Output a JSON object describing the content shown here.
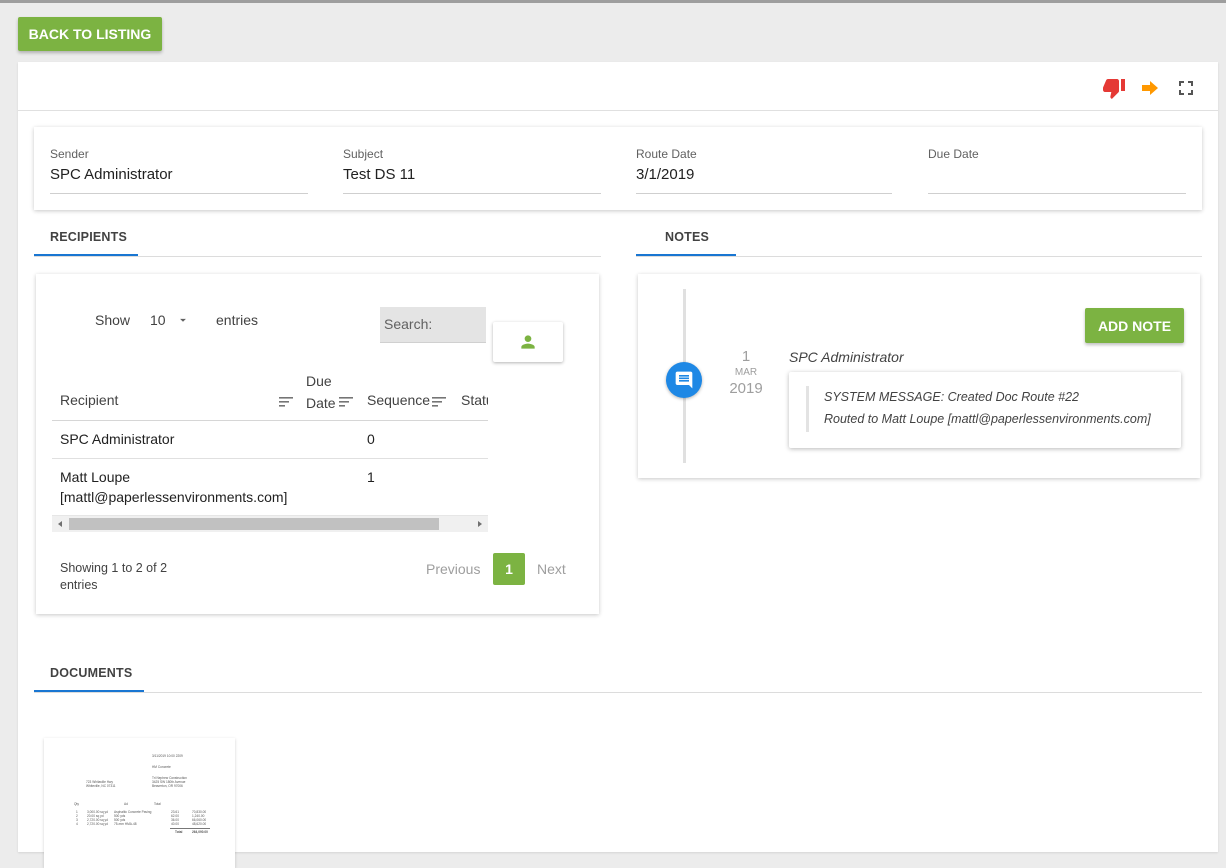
{
  "toolbar": {
    "back_label": "BACK TO LISTING"
  },
  "header_icons": [
    "thumbs-down-icon",
    "arrow-right-icon",
    "fullscreen-icon"
  ],
  "colors": {
    "accent_green": "#7cb342",
    "accent_blue": "#1976d2",
    "thumbs_red": "#e53935",
    "arrow_orange": "#ff9800",
    "timeline_blue": "#1e88e5"
  },
  "info": {
    "sender": {
      "label": "Sender",
      "value": "SPC Administrator"
    },
    "subject": {
      "label": "Subject",
      "value": "Test DS 11"
    },
    "route_date": {
      "label": "Route Date",
      "value": "3/1/2019"
    },
    "due_date": {
      "label": "Due Date",
      "value": ""
    }
  },
  "tabs": {
    "recipients": "RECIPIENTS",
    "notes": "NOTES",
    "documents": "DOCUMENTS"
  },
  "recipients": {
    "show_label": "Show",
    "page_size": "10",
    "entries_label": "entries",
    "search_placeholder": "Search:",
    "columns": {
      "recipient": "Recipient",
      "due_line1": "Due",
      "due_line2": "Date",
      "sequence": "Sequence",
      "status": "Statu"
    },
    "rows": [
      {
        "recipient": "SPC Administrator",
        "sequence": "0"
      },
      {
        "recipient_line1": "Matt Loupe",
        "recipient_line2": "[mattl@paperlessenvironments.com]",
        "sequence": "1"
      }
    ],
    "info_line1": "Showing 1 to 2 of 2",
    "info_line2": "entries",
    "pagination": {
      "previous": "Previous",
      "current": "1",
      "next": "Next"
    }
  },
  "notes": {
    "add_label": "ADD NOTE",
    "items": [
      {
        "day": "1",
        "month": "MAR",
        "year": "2019",
        "author": "SPC Administrator",
        "line1": "SYSTEM MESSAGE: Created Doc Route #22",
        "line2": "Routed to Matt Loupe [mattl@paperlessenvironments.com]"
      }
    ]
  },
  "documents": {
    "thumbnail": {
      "header_line": "3/11/2019  10:00  2209",
      "sub_line": "HM Concrete",
      "addr_left_1": "723 Whitaville Hwy",
      "addr_left_2": "Whiteville, NC 07311",
      "addr_right_1": "Tri Nephew Construction",
      "addr_right_2": "3425 SW 180th Avenue",
      "addr_right_3": "Beaverton, OR 97006",
      "col_qty": "Qty",
      "col_desc": "Ad",
      "col_total": "Total",
      "lines": [
        [
          "1",
          "3,000.00  sq yd",
          "Asphaltic Concrete Paving",
          "23.61",
          "70,830.00"
        ],
        [
          "2",
          "20.00  sq yd",
          "500 yds",
          "62.00",
          "1,240.00"
        ],
        [
          "3",
          "2,720.00  sq yd",
          "500 yds",
          "36.00",
          "66,060.00"
        ],
        [
          "4",
          "2,720.00  sq yd",
          "75-mm HMA-48",
          "40.00",
          "48,620.00"
        ]
      ],
      "total_label": "Total",
      "total_value": "264,090.00"
    }
  }
}
